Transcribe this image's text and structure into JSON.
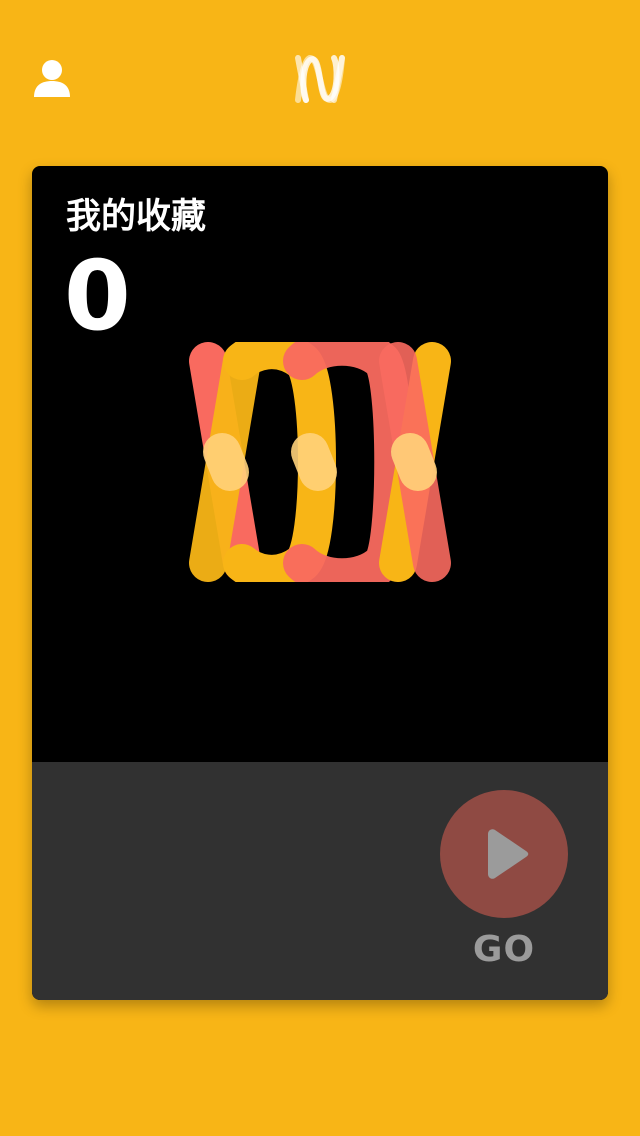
{
  "header": {
    "profile_icon": "user-icon",
    "logo_icon": "app-logo-icon"
  },
  "favorites": {
    "title": "我的收藏",
    "count": "0",
    "art_icon": "loops-logo-icon"
  },
  "footer": {
    "go_icon": "play-icon",
    "go_label": "GO"
  },
  "colors": {
    "background": "#F8B516",
    "card": "#000000",
    "footer": "#313131",
    "accent_red": "#F96A5F",
    "accent_yellow": "#F8B516",
    "go_button": "#8F4A43",
    "go_label": "#9B9B9B"
  }
}
